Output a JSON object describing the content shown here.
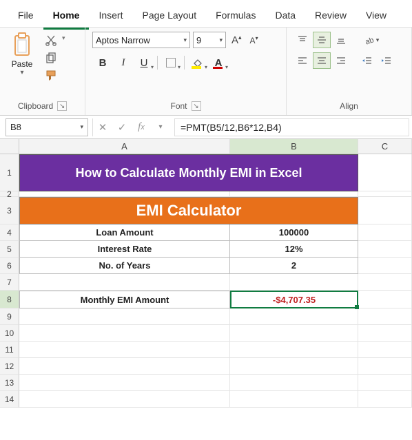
{
  "tabs": {
    "file": "File",
    "home": "Home",
    "insert": "Insert",
    "pagelayout": "Page Layout",
    "formulas": "Formulas",
    "data": "Data",
    "review": "Review",
    "view": "View"
  },
  "ribbon": {
    "clipboard": {
      "paste": "Paste",
      "label": "Clipboard"
    },
    "font": {
      "name": "Aptos Narrow",
      "size": "9",
      "label": "Font",
      "bold": "B",
      "italic": "I",
      "underline": "U",
      "a_caps": "A"
    },
    "align": {
      "label": "Align"
    }
  },
  "namebox": "B8",
  "formula": "=PMT(B5/12,B6*12,B4)",
  "cols": {
    "A": "A",
    "B": "B",
    "C": "C"
  },
  "rows": [
    "1",
    "2",
    "3",
    "4",
    "5",
    "6",
    "7",
    "8",
    "9",
    "10",
    "11",
    "12",
    "13",
    "14"
  ],
  "sheet": {
    "title": "How to Calculate Monthly EMI in Excel",
    "header": "EMI Calculator",
    "r4a": "Loan Amount",
    "r4b": "100000",
    "r5a": "Interest Rate",
    "r5b": "12%",
    "r6a": "No. of Years",
    "r6b": "2",
    "r8a": "Monthly EMI Amount",
    "r8b": "-$4,707.35"
  }
}
